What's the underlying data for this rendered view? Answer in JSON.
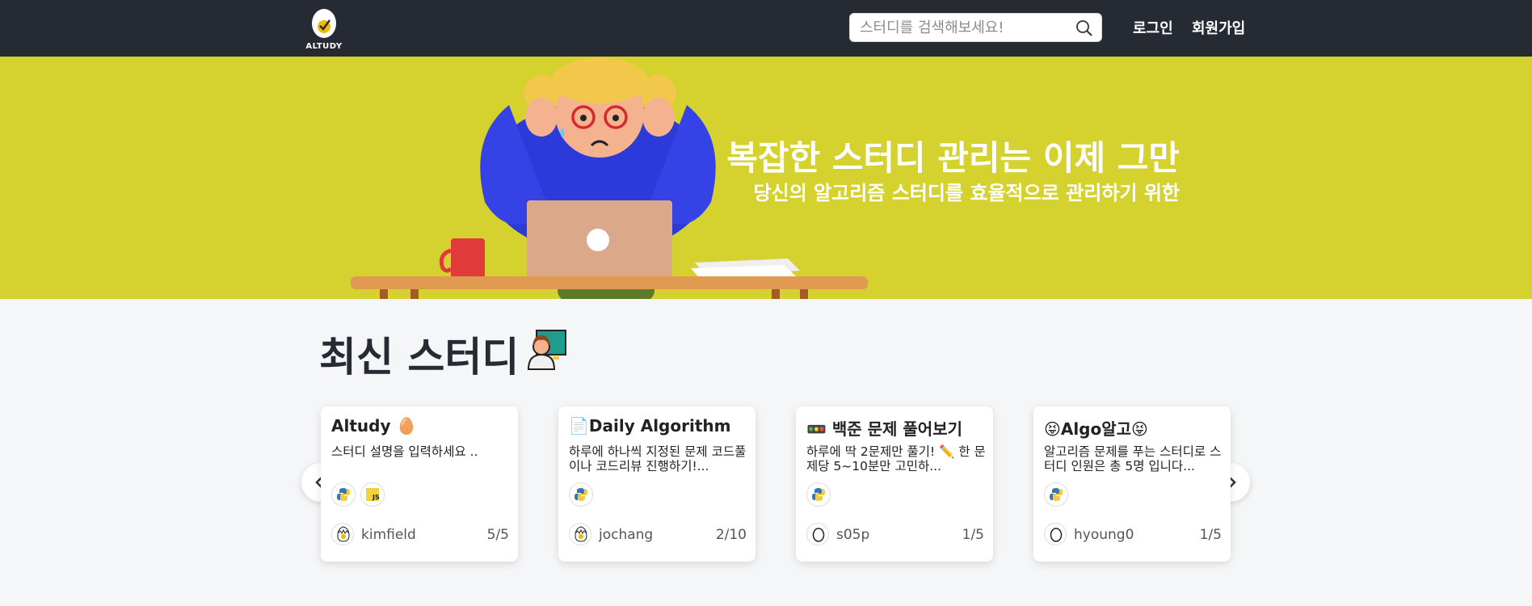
{
  "header": {
    "logo_text": "ALTUDY",
    "search_placeholder": "스터디를 검색해보세요!",
    "login_label": "로그인",
    "signup_label": "회원가입"
  },
  "hero": {
    "title": "복잡한 스터디 관리는 이제 그만",
    "subtitle": "당신의 알고리즘 스터디를 효율적으로 관리하기 위한"
  },
  "section": {
    "title": "최신 스터디"
  },
  "cards": [
    {
      "title": "Altudy 🥚",
      "description": "스터디 설명을 입력하세요 ..",
      "languages": [
        "python-icon",
        "javascript-icon"
      ],
      "owner": "kimfield",
      "count": "5/5"
    },
    {
      "title": "📄Daily Algorithm",
      "description": "하루에 하나씩 지정된 문제 코드풀이나 코드리뷰 진행하기!...",
      "languages": [
        "python-icon"
      ],
      "owner": "jochang",
      "count": "2/10"
    },
    {
      "title": "🚥 백준 문제 풀어보기",
      "description": "하루에 딱 2문제만 풀기! ✏️ 한 문제당 5~10분만 고민하...",
      "languages": [
        "python-icon"
      ],
      "owner": "s05p",
      "count": "1/5"
    },
    {
      "title": "😝Algo알고😝",
      "description": "알고리즘 문제를 푸는 스터디로 스터디 인원은 총 5명 입니다...",
      "languages": [
        "python-icon"
      ],
      "owner": "hyoung0",
      "count": "1/5"
    }
  ],
  "colors": {
    "header_bg": "#262a33",
    "hero_bg": "#d5d230",
    "page_bg": "#f5f6f8"
  }
}
